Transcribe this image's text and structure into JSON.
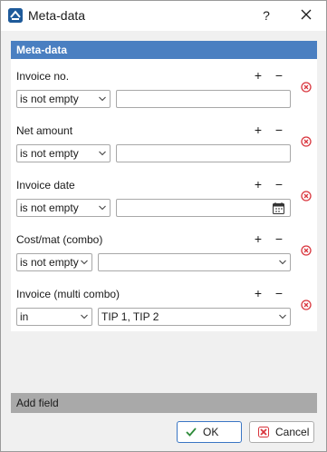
{
  "window": {
    "title": "Meta-data",
    "help_label": "?",
    "close_label": "close"
  },
  "panel": {
    "header": "Meta-data",
    "plus_label": "+",
    "minus_label": "−",
    "fields": [
      {
        "label": "Invoice no.",
        "operator": "is not empty",
        "value": "",
        "value_kind": "text"
      },
      {
        "label": "Net amount",
        "operator": "is not empty",
        "value": "",
        "value_kind": "text"
      },
      {
        "label": "Invoice date",
        "operator": "is not empty",
        "value": "",
        "value_kind": "date"
      },
      {
        "label": "Cost/mat (combo)",
        "operator": "is not empty",
        "value": "",
        "value_kind": "combo"
      },
      {
        "label": "Invoice (multi combo)",
        "operator": "in",
        "value": "TIP 1, TIP 2",
        "value_kind": "combo"
      }
    ]
  },
  "footer": {
    "add_field_label": "Add field",
    "ok_label": "OK",
    "cancel_label": "Cancel"
  },
  "colors": {
    "header_bg": "#4a7fc1",
    "remove_icon": "#d9363e",
    "ok_check": "#2e8b3a",
    "add_field_bg": "#a9a9a9"
  },
  "icons": {
    "app": "app-logo-icon",
    "close": "close-icon",
    "remove": "remove-circle-icon",
    "chevron": "chevron-down-icon",
    "calendar": "calendar-icon",
    "ok": "check-icon",
    "cancel": "cross-icon"
  }
}
